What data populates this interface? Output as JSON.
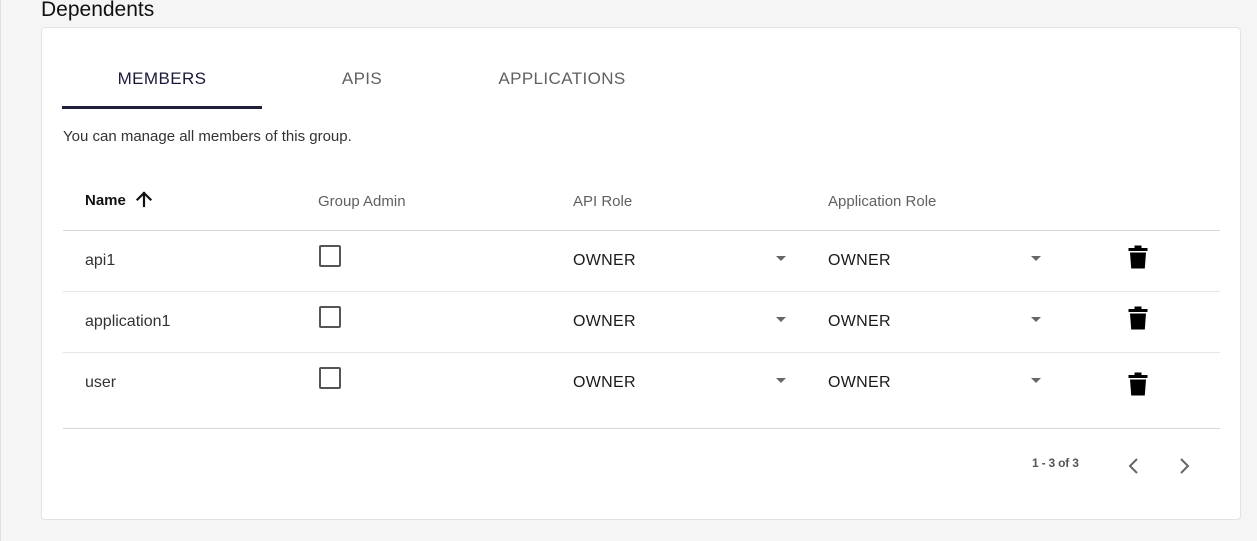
{
  "section_title": "Dependents",
  "tabs": [
    {
      "label": "MEMBERS",
      "active": true
    },
    {
      "label": "APIS",
      "active": false
    },
    {
      "label": "APPLICATIONS",
      "active": false
    }
  ],
  "hint": "You can manage all members of this group.",
  "table": {
    "headers": {
      "name": "Name",
      "group_admin": "Group Admin",
      "api_role": "API Role",
      "application_role": "Application Role"
    },
    "sort": {
      "column": "Name",
      "direction": "ascending",
      "icon": "arrow-up-icon"
    },
    "rows": [
      {
        "name": "api1",
        "group_admin": false,
        "api_role": "OWNER",
        "application_role": "OWNER"
      },
      {
        "name": "application1",
        "group_admin": false,
        "api_role": "OWNER",
        "application_role": "OWNER"
      },
      {
        "name": "user",
        "group_admin": false,
        "api_role": "OWNER",
        "application_role": "OWNER"
      }
    ],
    "row_action_icon": "trash-icon"
  },
  "paginator": {
    "range_label": "1 - 3 of 3",
    "prev_icon": "chevron-left-icon",
    "next_icon": "chevron-right-icon"
  },
  "colors": {
    "accent": "#1f1f3a",
    "background": "#f5f5f5",
    "card": "#ffffff"
  }
}
